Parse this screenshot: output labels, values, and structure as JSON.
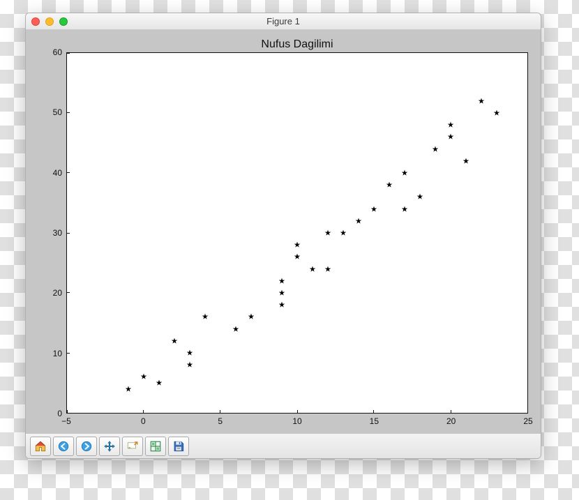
{
  "window": {
    "title": "Figure 1"
  },
  "toolbar": {
    "home": "home-icon",
    "back": "back-icon",
    "forward": "forward-icon",
    "pan": "pan-icon",
    "zoom": "zoom-icon",
    "subplots": "subplots-icon",
    "save": "save-icon"
  },
  "chart_data": {
    "type": "scatter",
    "title": "Nufus Dagilimi",
    "xlabel": "",
    "ylabel": "",
    "xlim": [
      -5,
      25
    ],
    "ylim": [
      0,
      60
    ],
    "xticks": [
      -5,
      0,
      5,
      10,
      15,
      20,
      25
    ],
    "yticks": [
      0,
      10,
      20,
      30,
      40,
      50,
      60
    ],
    "marker": "star",
    "x": [
      -1,
      0,
      1,
      2,
      3,
      3,
      4,
      6,
      7,
      9,
      9,
      9,
      10,
      10,
      11,
      12,
      12,
      13,
      14,
      15,
      16,
      17,
      17,
      18,
      19,
      20,
      20,
      21,
      22,
      23
    ],
    "y": [
      4,
      6,
      5,
      12,
      10,
      8,
      16,
      14,
      16,
      22,
      20,
      18,
      28,
      26,
      24,
      30,
      24,
      30,
      32,
      34,
      38,
      40,
      34,
      36,
      44,
      48,
      46,
      42,
      52,
      50
    ]
  }
}
